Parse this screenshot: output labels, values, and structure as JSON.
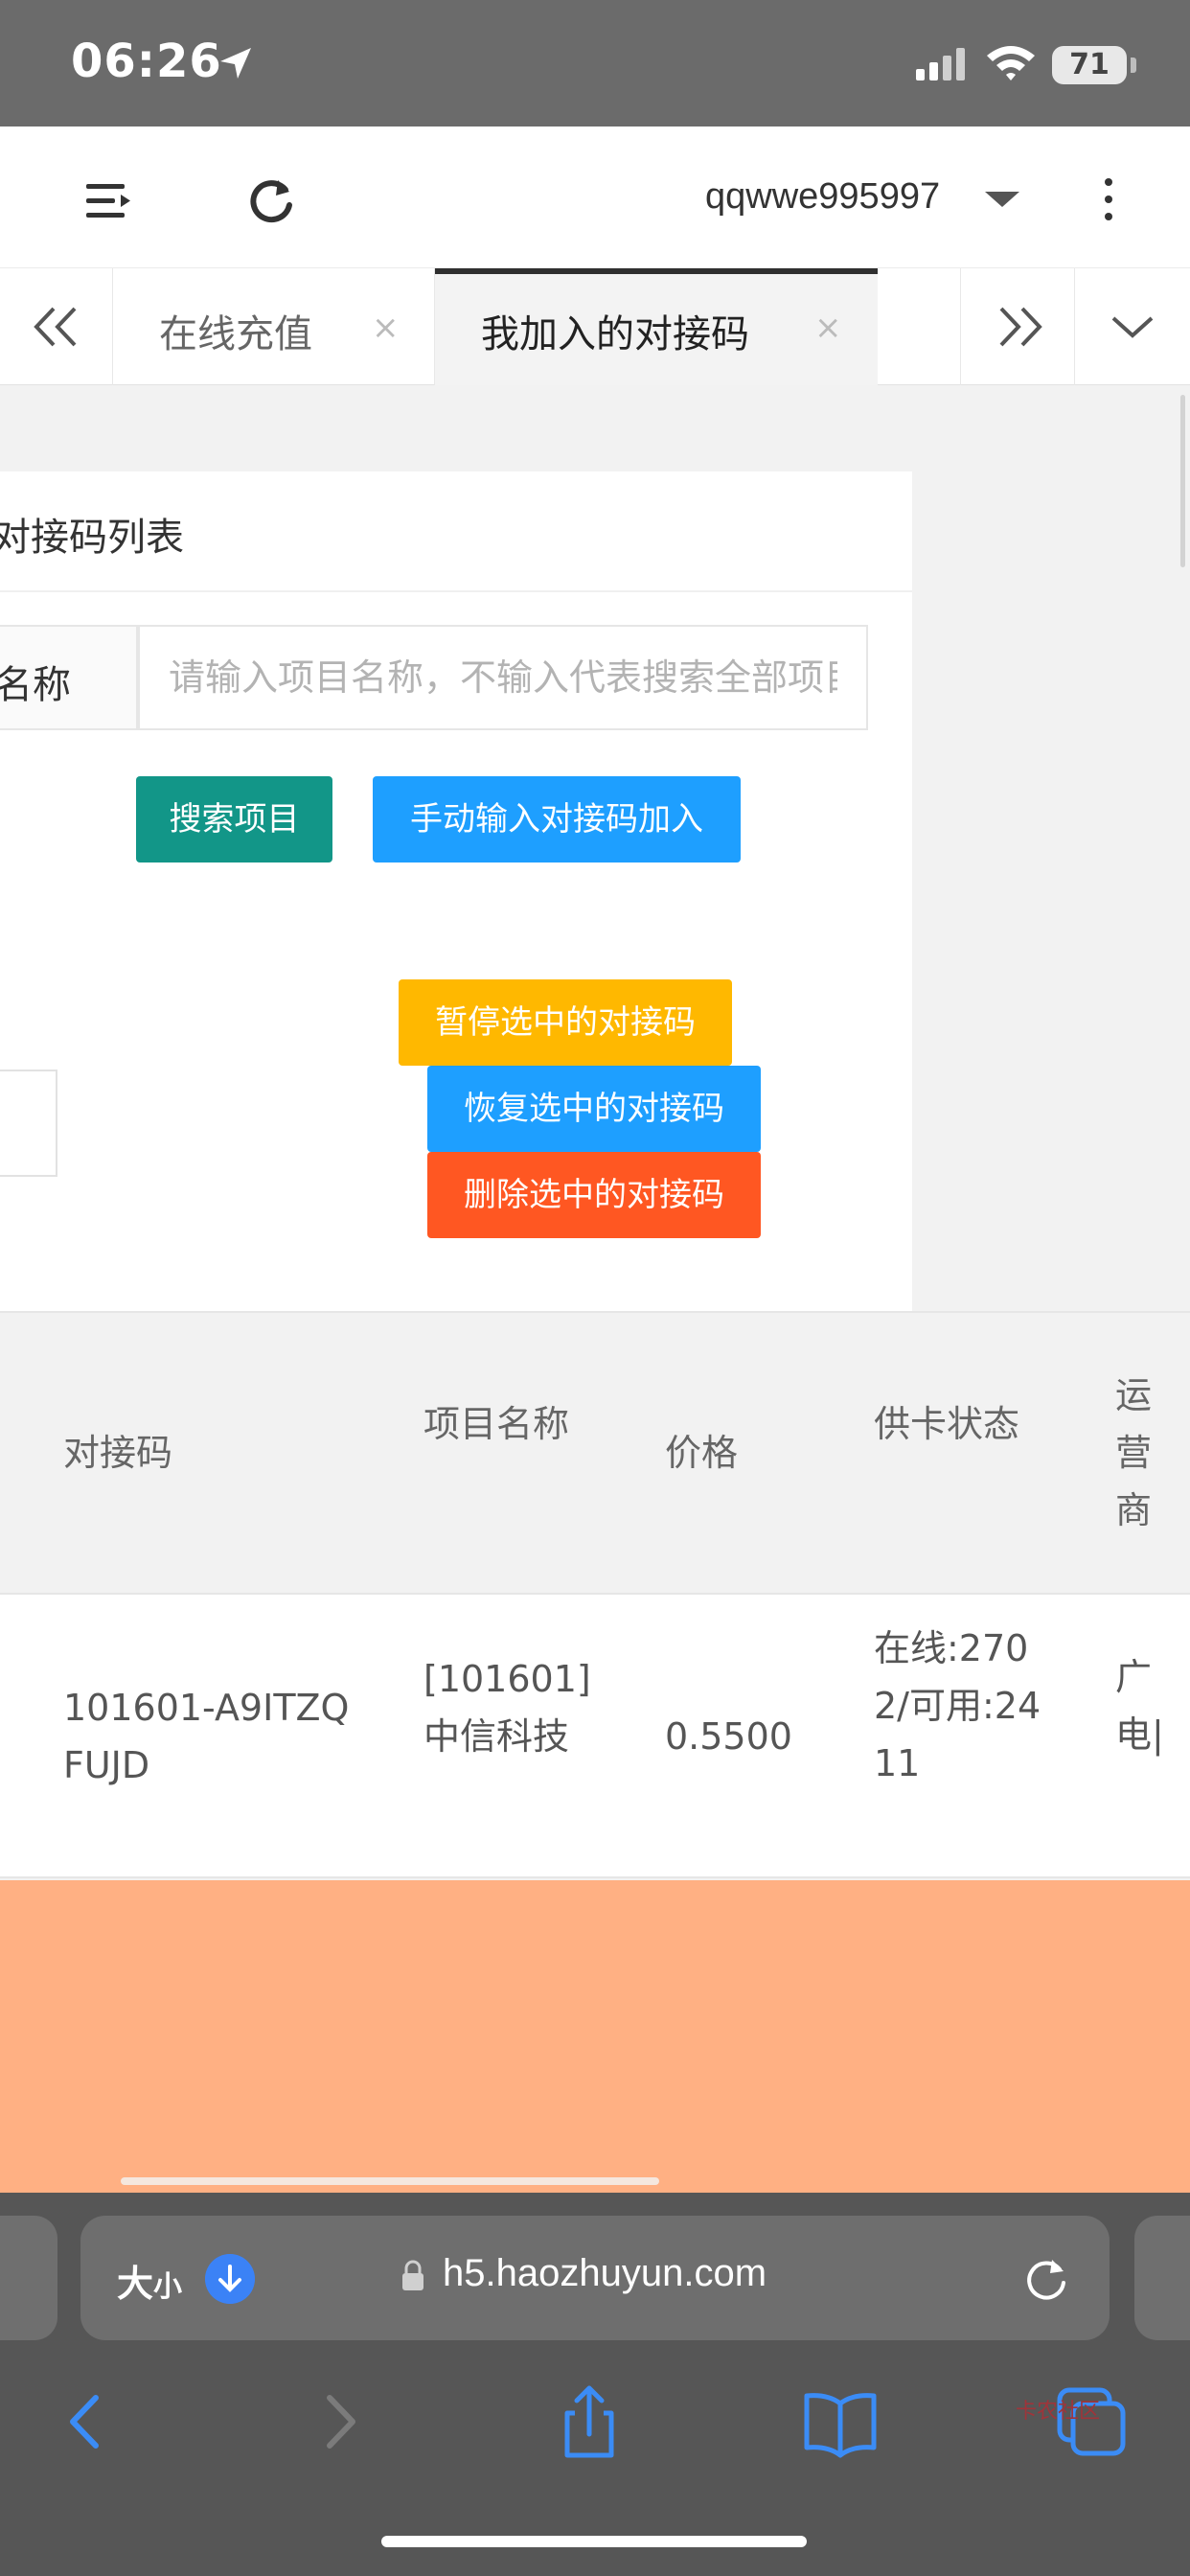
{
  "status_bar": {
    "time": "06:26",
    "battery": "71"
  },
  "header": {
    "username": "qqwwe995997"
  },
  "tabs": [
    {
      "label": "在线充值",
      "close": "×"
    },
    {
      "label": "我加入的对接码",
      "close": "×"
    }
  ],
  "card": {
    "title": "对接码列表",
    "search_label": "名称",
    "search_placeholder": "请输入项目名称，不输入代表搜索全部项目",
    "buttons": {
      "search": "搜索项目",
      "manual_add": "手动输入对接码加入",
      "pause": "暂停选中的对接码",
      "resume": "恢复选中的对接码",
      "delete": "删除选中的对接码"
    }
  },
  "table": {
    "headers": {
      "code": "对接码",
      "name": "项目名称",
      "price": "价格",
      "status": "供卡状态",
      "operator": "运营商"
    },
    "rows": [
      {
        "code": "101601-A9ITZQFUJD",
        "name": "[101601]中信科技",
        "price": "0.5500",
        "status": "在线:2702/可用:2411",
        "operator": "广电|"
      }
    ]
  },
  "browser": {
    "size_label": "大",
    "size_label_small": "小",
    "url": "h5.haozhuyun.com"
  },
  "watermark": "卡农社区",
  "colors": {
    "search_button": "#129688",
    "blue_button": "#1e9fff",
    "pause_button": "#ffb800",
    "delete_button": "#ff5722",
    "bottom_area": "#ffb083"
  }
}
